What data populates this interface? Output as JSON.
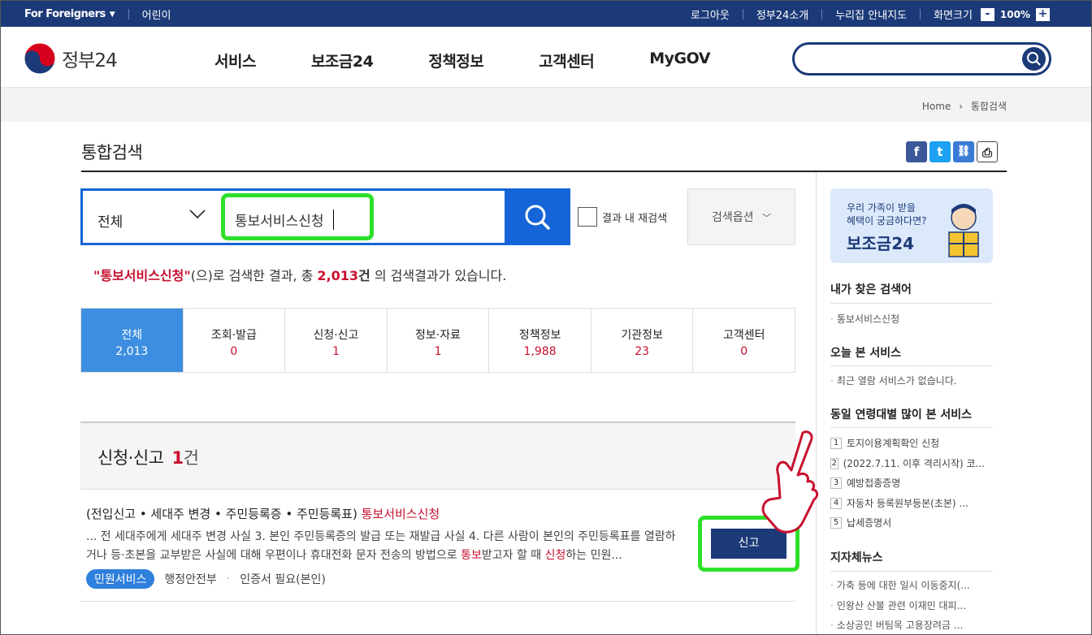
{
  "util": {
    "foreigners": "For Foreigners",
    "kids": "어린이",
    "logout": "로그아웃",
    "about": "정부24소개",
    "guide": "누리집 안내지도",
    "screen": "화면크기",
    "zoom_minus": "-",
    "zoom_value": "100%",
    "zoom_plus": "+"
  },
  "header": {
    "logo_text": "정부24",
    "menu": [
      "서비스",
      "보조금24",
      "정책정보",
      "고객센터",
      "MyGOV"
    ]
  },
  "breadcrumb": {
    "home": "Home",
    "current": "통합검색"
  },
  "page_title": "통합검색",
  "sns": {
    "facebook": "f",
    "twitter": "t",
    "link": "⛓",
    "print": "⎙"
  },
  "search": {
    "scope": "전체",
    "keyword": "통보서비스신청",
    "within_results": "결과 내 재검색",
    "options": "검색옵션"
  },
  "result_msg": {
    "keyword": "\"통보서비스신청\"",
    "p1": "(으)로 검색한 결과, 총 ",
    "count": "2,013",
    "unit": "건",
    "p2": " 의 검색결과가 있습니다."
  },
  "tabs": [
    {
      "label": "전체",
      "count": "2,013"
    },
    {
      "label": "조회·발급",
      "count": "0"
    },
    {
      "label": "신청·신고",
      "count": "1"
    },
    {
      "label": "정보·자료",
      "count": "1"
    },
    {
      "label": "정책정보",
      "count": "1,988"
    },
    {
      "label": "기관정보",
      "count": "23"
    },
    {
      "label": "고객센터",
      "count": "0"
    }
  ],
  "section": {
    "title": "신청·신고",
    "count": "1",
    "unit": "건"
  },
  "result": {
    "title_prefix": "(전입신고 • 세대주 변경 • 주민등록증 • 주민등록표) ",
    "title_hl": "통보서비스신청",
    "desc1": "... 전 세대주에게 세대주 변경 사실 3. 본인 주민등록증의 발급 또는 재발급 사실 4. 다른 사람이 본인의 주민등록표를 열람하거나 등·초본을 교부받은 사실에 대해 우편이나 휴대전화 문자 전송의 방법으로 ",
    "hl1": "통보",
    "desc2": "받고자 할 때 ",
    "hl2": "신청",
    "desc3": "하는 민원...",
    "badge": "민원서비스",
    "agency": "행정안전부",
    "cert": "인증서 필요(본인)",
    "button": "신고"
  },
  "banner": {
    "line1": "우리 가족이 받을",
    "line2": "혜택이 궁금하다면?",
    "title": "보조금24"
  },
  "sidebar": {
    "my_search_title": "내가 찾은 검색어",
    "my_search": [
      "통보서비스신청"
    ],
    "today_title": "오늘 본 서비스",
    "today": [
      "최근 열람 서비스가 없습니다."
    ],
    "age_title": "동일 연령대별 많이 본 서비스",
    "age_list": [
      "토지이용계획확인 신청",
      "(2022.7.11. 이후 격리시작) 코...",
      "예방접종증명",
      "자동차 등록원부등본(초본) ...",
      "납세증명서"
    ],
    "news_title": "지자체뉴스",
    "news": [
      "가축 등에 대한 일시 이동중지(...",
      "인왕산 산불 관련 이재민 대피...",
      "소상공인 버팀목 고용장려금 ..."
    ]
  },
  "colors": {
    "navy": "#1c3a78",
    "blue": "#1565d8",
    "highlight": "#2ee02a",
    "red": "#c8102e"
  }
}
